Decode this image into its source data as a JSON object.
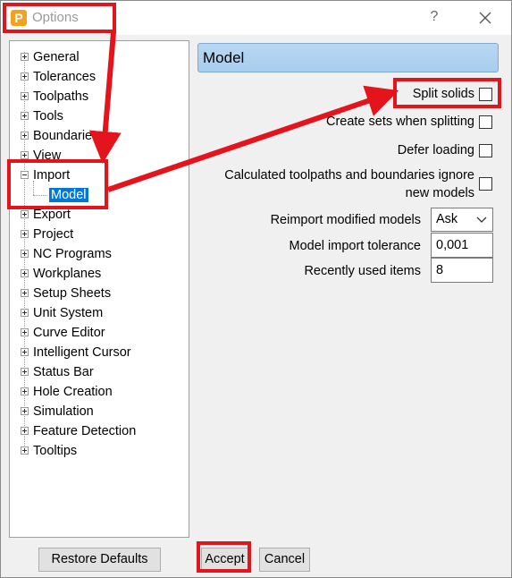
{
  "window": {
    "title": "Options",
    "app_icon_letter": "P",
    "help_label": "?"
  },
  "tree": {
    "items": [
      {
        "label": "General",
        "expander": "plus"
      },
      {
        "label": "Tolerances",
        "expander": "plus"
      },
      {
        "label": "Toolpaths",
        "expander": "plus"
      },
      {
        "label": "Tools",
        "expander": "plus"
      },
      {
        "label": "Boundaries",
        "expander": "plus"
      },
      {
        "label": "View",
        "expander": "plus"
      },
      {
        "label": "Import",
        "expander": "minus"
      },
      {
        "label": "Model",
        "expander": "none",
        "selected": true
      },
      {
        "label": "Export",
        "expander": "plus"
      },
      {
        "label": "Project",
        "expander": "plus"
      },
      {
        "label": "NC Programs",
        "expander": "plus"
      },
      {
        "label": "Workplanes",
        "expander": "plus"
      },
      {
        "label": "Setup Sheets",
        "expander": "plus"
      },
      {
        "label": "Unit System",
        "expander": "plus"
      },
      {
        "label": "Curve Editor",
        "expander": "plus"
      },
      {
        "label": "Intelligent Cursor",
        "expander": "plus"
      },
      {
        "label": "Status Bar",
        "expander": "plus"
      },
      {
        "label": "Hole Creation",
        "expander": "plus"
      },
      {
        "label": "Simulation",
        "expander": "plus"
      },
      {
        "label": "Feature Detection",
        "expander": "plus"
      },
      {
        "label": "Tooltips",
        "expander": "plus"
      }
    ]
  },
  "panel": {
    "header": "Model",
    "options": {
      "split_solids": {
        "label": "Split solids",
        "checked": false
      },
      "create_sets": {
        "label": "Create sets when splitting",
        "checked": false
      },
      "defer_loading": {
        "label": "Defer loading",
        "checked": false
      },
      "calc_toolpaths": {
        "label_line1": "Calculated toolpaths and boundaries ignore",
        "label_line2": "new models",
        "checked": false
      }
    },
    "reimport": {
      "label": "Reimport modified models",
      "value": "Ask"
    },
    "tolerance": {
      "label": "Model import tolerance",
      "value": "0,001"
    },
    "recent": {
      "label": "Recently used items",
      "value": "8"
    }
  },
  "footer": {
    "restore": "Restore Defaults",
    "accept": "Accept",
    "cancel": "Cancel"
  },
  "colors": {
    "annotation": "#e3141c",
    "selection": "#0078d7",
    "panel_header": "#b9d7f1"
  }
}
